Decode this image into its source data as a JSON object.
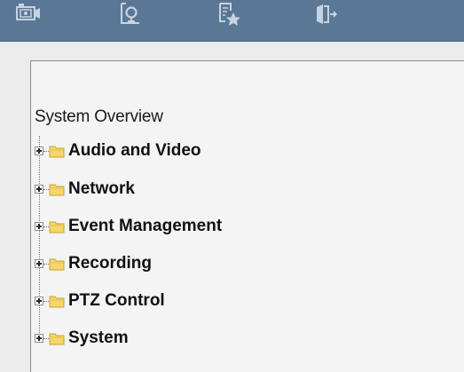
{
  "toolbar": {
    "buttons": [
      {
        "icon": "camera-preview-icon"
      },
      {
        "icon": "playback-search-icon"
      },
      {
        "icon": "log-favorite-icon"
      },
      {
        "icon": "logout-door-icon"
      }
    ]
  },
  "tree": {
    "root_label": "System Overview",
    "items": [
      {
        "label": "Audio and Video"
      },
      {
        "label": "Network"
      },
      {
        "label": "Event Management"
      },
      {
        "label": "Recording"
      },
      {
        "label": "PTZ Control"
      },
      {
        "label": "System"
      }
    ]
  },
  "colors": {
    "toolbar": "#5b7796",
    "band": "#ececec",
    "panel": "#f4f4f4",
    "folder_fill": "#f5d66a",
    "folder_stroke": "#c9a22e"
  }
}
